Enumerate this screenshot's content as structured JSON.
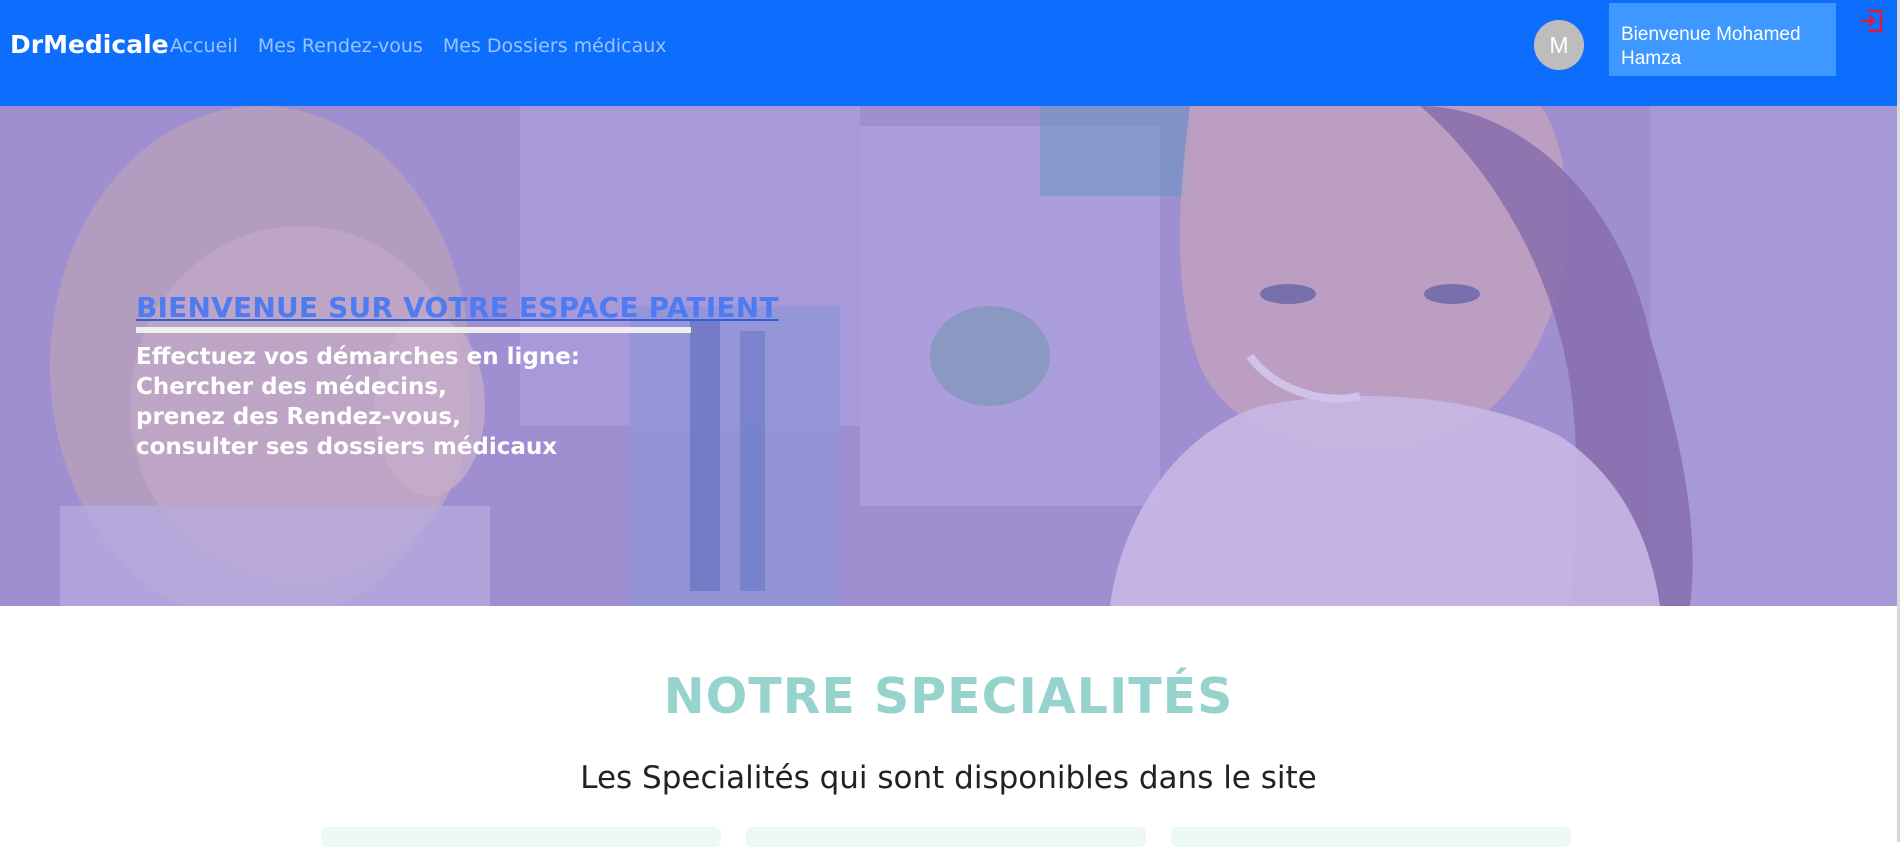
{
  "navbar": {
    "brand": "DrMedicale",
    "links": [
      "Accueil",
      "Mes Rendez-vous",
      "Mes Dossiers médicaux"
    ],
    "avatar_initial": "M",
    "welcome_text": "Bienvenue Mohamed Hamza",
    "logout_icon": "logout-icon",
    "colors": {
      "background": "#0d6efd",
      "welcome_button": "#3d98ff",
      "logout_icon": "#e0193a"
    }
  },
  "hero": {
    "title": "BIENVENUE SUR VOTRE ESPACE PATIENT",
    "lines": [
      "Effectuez vos démarches en ligne:",
      "Chercher des médecins,",
      "prenez des Rendez-vous,",
      "consulter ses dossiers médicaux"
    ],
    "colors": {
      "title": "#4f7bf0",
      "text": "#ffffff",
      "overlay": "#9c92c8"
    }
  },
  "specialites": {
    "title": "NOTRE SPECIALITÉS",
    "subtitle": "Les Specialités qui sont disponibles dans le site",
    "colors": {
      "title": "#96d3cc",
      "card_background": "#ecf8f5"
    }
  }
}
